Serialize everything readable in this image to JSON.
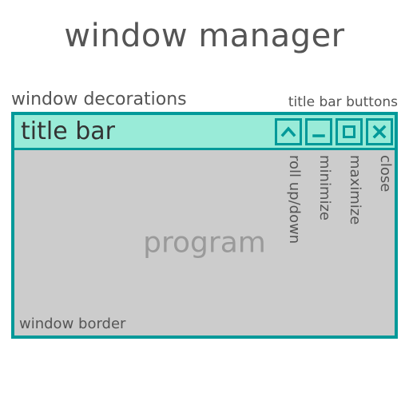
{
  "heading": "window manager",
  "labels": {
    "decorations": "window decorations",
    "titlebar_buttons": "title bar buttons",
    "titlebar": "title bar",
    "program": "program",
    "window_border": "window border"
  },
  "buttons": {
    "rollup": {
      "name": "roll up/down"
    },
    "minimize": {
      "name": "minimize"
    },
    "maximize": {
      "name": "maximize"
    },
    "close": {
      "name": "close"
    }
  },
  "colors": {
    "border": "#009999",
    "titlebar_bg": "#99ebd8",
    "content_bg": "#cccccc"
  }
}
